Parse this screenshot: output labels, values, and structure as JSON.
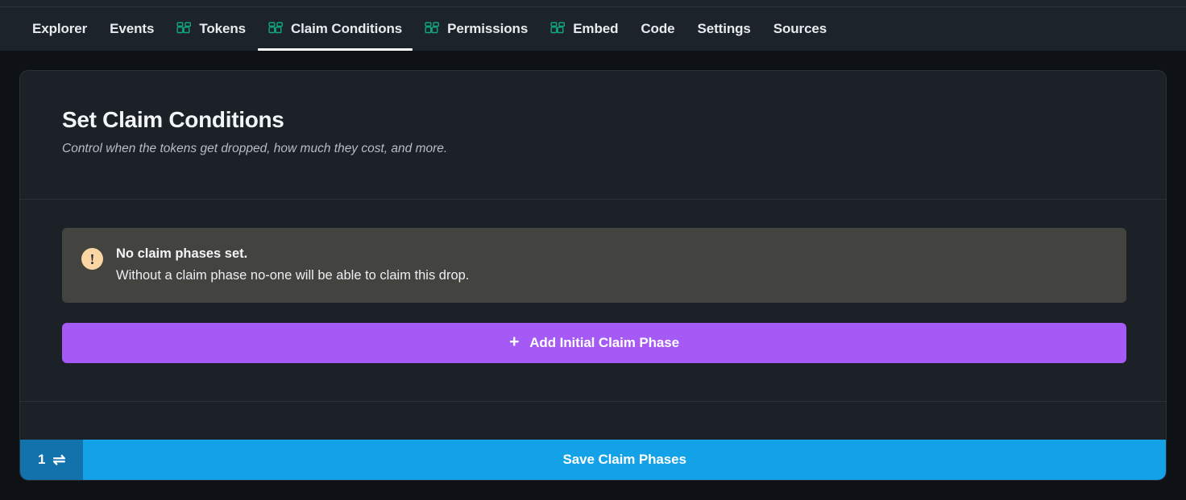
{
  "nav": {
    "items": [
      {
        "label": "Explorer",
        "icon": null,
        "active": false
      },
      {
        "label": "Events",
        "icon": null,
        "active": false
      },
      {
        "label": "Tokens",
        "icon": "widget-icon",
        "active": false
      },
      {
        "label": "Claim Conditions",
        "icon": "widget-icon",
        "active": true
      },
      {
        "label": "Permissions",
        "icon": "widget-icon",
        "active": false
      },
      {
        "label": "Embed",
        "icon": "widget-icon",
        "active": false
      },
      {
        "label": "Code",
        "icon": null,
        "active": false
      },
      {
        "label": "Settings",
        "icon": null,
        "active": false
      },
      {
        "label": "Sources",
        "icon": null,
        "active": false
      }
    ]
  },
  "card": {
    "title": "Set Claim Conditions",
    "subtitle": "Control when the tokens get dropped, how much they cost, and more.",
    "alert": {
      "icon": "exclamation-circle-icon",
      "title": "No claim phases set.",
      "description": "Without a claim phase no-one will be able to claim this drop."
    },
    "add_phase_button": {
      "plus": "+",
      "label": "Add Initial Claim Phase"
    }
  },
  "action_bar": {
    "tx_count": "1",
    "tx_arrows": "⇌",
    "save_label": "Save Claim Phases"
  },
  "colors": {
    "page_bg": "#0e1116",
    "nav_bg": "#1d232b",
    "card_bg": "#1c2128",
    "card_border": "#2a313a",
    "icon_green": "#12a67d",
    "alert_bg": "#434340",
    "alert_icon_bg": "#f9d6a4",
    "purple_accent": "#a55af5",
    "blue_accent": "#13a2e8",
    "blue_badge": "#1272ab",
    "active_underline": "#ffffff"
  }
}
